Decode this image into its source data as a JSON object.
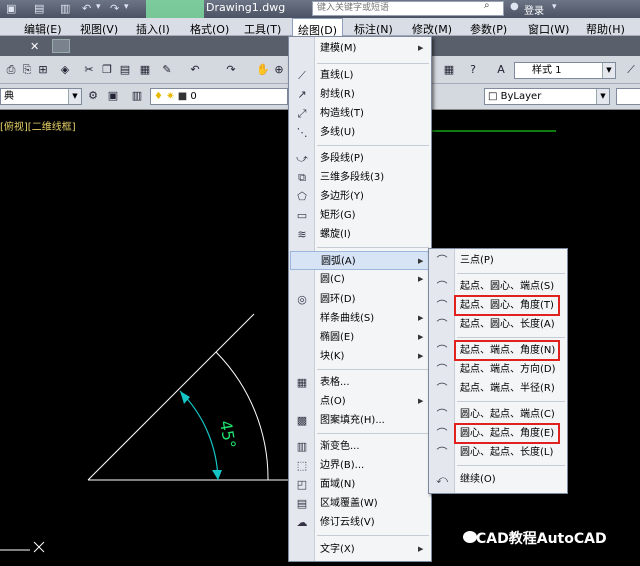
{
  "titlebar": {
    "document_title": "Drawing1.dwg",
    "search_placeholder": "键入关键字或短语",
    "login_label": "登录"
  },
  "menubar": {
    "items": [
      "编辑(E)",
      "视图(V)",
      "插入(I)",
      "格式(O)",
      "工具(T)",
      "绘图(D)",
      "标注(N)",
      "修改(M)",
      "参数(P)",
      "窗口(W)",
      "帮助(H)"
    ],
    "active": "绘图(D)"
  },
  "toolbar": {
    "layer_combo_value": "典",
    "layer_value": "0",
    "style_label": "样式 1",
    "bylayer_value": "ByLayer"
  },
  "drawing": {
    "layout_label": "[俯视][二维线框]",
    "angle_label": "45°",
    "colors": {
      "background": "#000000",
      "lines": "#ffffff",
      "dimension": "#15c4c4",
      "text": "#1fdf6a",
      "green_line": "#18c418"
    }
  },
  "draw_menu": {
    "items": [
      {
        "label": "建模(M)",
        "icon": "blank",
        "submenu": true
      },
      {
        "label": "直线(L)",
        "icon": "line-icon"
      },
      {
        "label": "射线(R)",
        "icon": "ray-icon"
      },
      {
        "label": "构造线(T)",
        "icon": "xline-icon"
      },
      {
        "label": "多线(U)",
        "icon": "mline-icon"
      },
      {
        "label": "多段线(P)",
        "icon": "pline-icon"
      },
      {
        "label": "三维多段线(3)",
        "icon": "3dpoly-icon"
      },
      {
        "label": "多边形(Y)",
        "icon": "polygon-icon"
      },
      {
        "label": "矩形(G)",
        "icon": "rectangle-icon"
      },
      {
        "label": "螺旋(I)",
        "icon": "helix-icon"
      },
      {
        "label": "圆弧(A)",
        "icon": "blank",
        "submenu": true,
        "highlighted": true
      },
      {
        "label": "圆(C)",
        "icon": "blank",
        "submenu": true
      },
      {
        "label": "圆环(D)",
        "icon": "donut-icon"
      },
      {
        "label": "样条曲线(S)",
        "icon": "blank",
        "submenu": true
      },
      {
        "label": "椭圆(E)",
        "icon": "blank",
        "submenu": true
      },
      {
        "label": "块(K)",
        "icon": "blank",
        "submenu": true
      },
      {
        "label": "表格...",
        "icon": "table-icon"
      },
      {
        "label": "点(O)",
        "icon": "blank",
        "submenu": true
      },
      {
        "label": "图案填充(H)...",
        "icon": "hatch-icon"
      },
      {
        "label": "渐变色...",
        "icon": "gradient-icon"
      },
      {
        "label": "边界(B)...",
        "icon": "boundary-icon"
      },
      {
        "label": "面域(N)",
        "icon": "region-icon"
      },
      {
        "label": "区域覆盖(W)",
        "icon": "wipeout-icon"
      },
      {
        "label": "修订云线(V)",
        "icon": "revcloud-icon"
      },
      {
        "label": "文字(X)",
        "icon": "blank",
        "submenu": true
      }
    ]
  },
  "arc_menu": {
    "items": [
      {
        "label": "三点(P)"
      },
      {
        "label": "起点、圆心、端点(S)"
      },
      {
        "label": "起点、圆心、角度(T)",
        "boxed": true
      },
      {
        "label": "起点、圆心、长度(A)"
      },
      {
        "label": "起点、端点、角度(N)",
        "boxed": true
      },
      {
        "label": "起点、端点、方向(D)"
      },
      {
        "label": "起点、端点、半径(R)"
      },
      {
        "label": "圆心、起点、端点(C)"
      },
      {
        "label": "圆心、起点、角度(E)",
        "boxed": true
      },
      {
        "label": "圆心、起点、长度(L)"
      },
      {
        "label": "继续(O)"
      }
    ],
    "box_color": "#e0221f"
  },
  "watermark": {
    "text": "CAD教程AutoCAD"
  }
}
